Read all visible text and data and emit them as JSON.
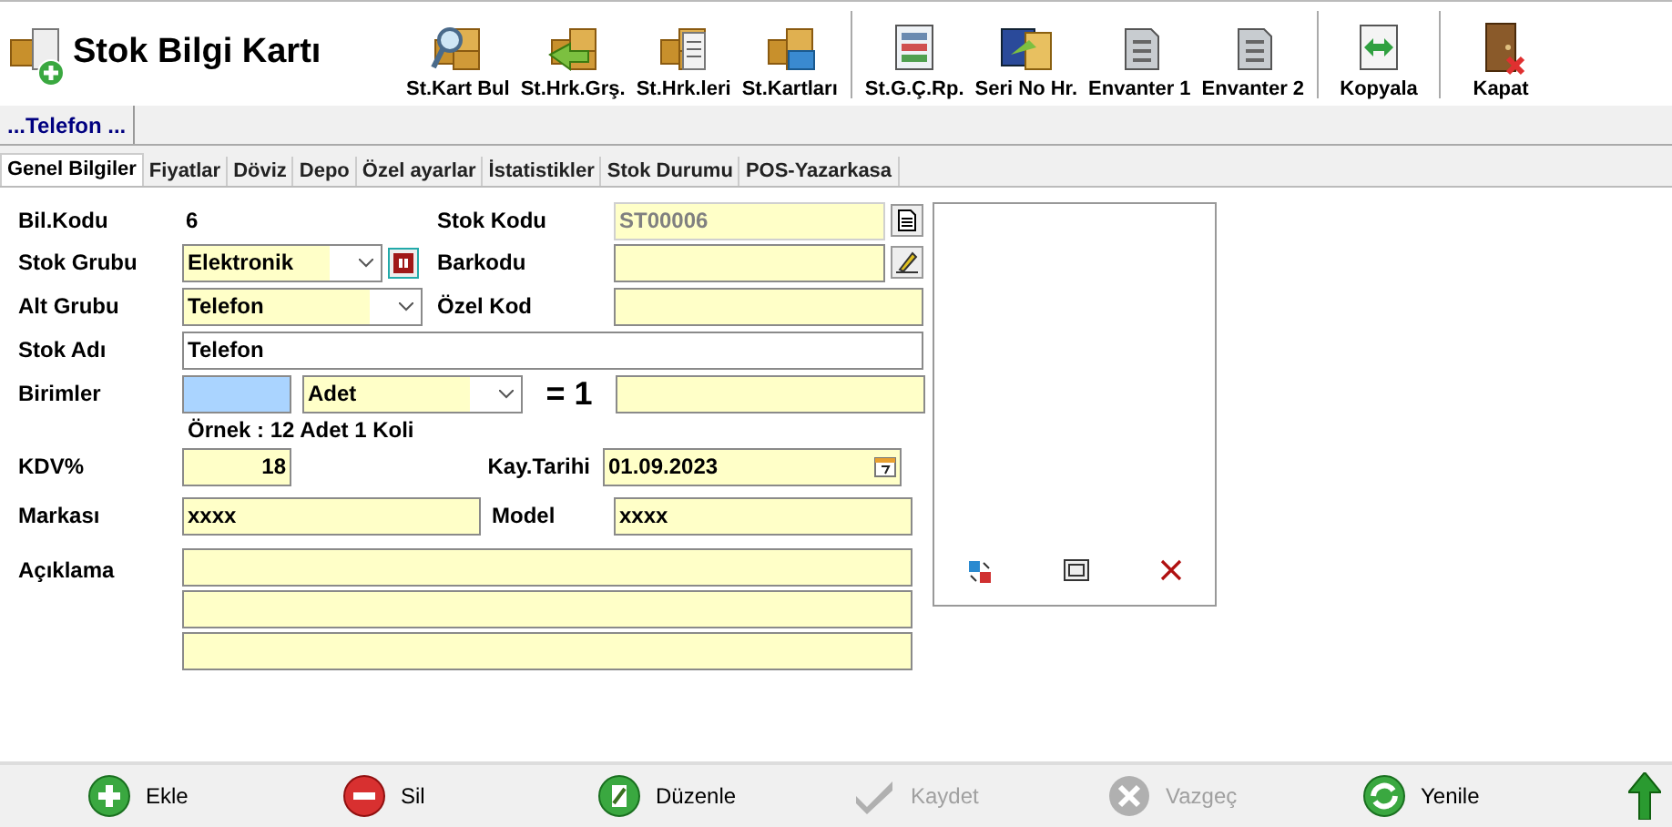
{
  "window": {
    "title": "Stok Bilgi Kartı"
  },
  "toolbar": [
    {
      "kind": "button",
      "label": "St.Kart Bul"
    },
    {
      "kind": "button",
      "label": "St.Hrk.Grş."
    },
    {
      "kind": "button",
      "label": "St.Hrk.leri"
    },
    {
      "kind": "button",
      "label": "St.Kartları"
    },
    {
      "kind": "separator"
    },
    {
      "kind": "button",
      "label": "St.G.Ç.Rp."
    },
    {
      "kind": "button",
      "label": "Seri No Hr."
    },
    {
      "kind": "button",
      "label": "Envanter 1"
    },
    {
      "kind": "button",
      "label": "Envanter 2"
    },
    {
      "kind": "separator"
    },
    {
      "kind": "button",
      "label": "Kopyala"
    },
    {
      "kind": "separator"
    },
    {
      "kind": "button",
      "label": "Kapat"
    }
  ],
  "record_tab": {
    "label": "...Telefon ..."
  },
  "tabs": [
    {
      "label": "Genel Bilgiler",
      "selected": true
    },
    {
      "label": "Fiyatlar",
      "selected": false
    },
    {
      "label": "Döviz",
      "selected": false
    },
    {
      "label": "Depo",
      "selected": false
    },
    {
      "label": "Özel ayarlar",
      "selected": false
    },
    {
      "label": "İstatistikler",
      "selected": false
    },
    {
      "label": "Stok Durumu",
      "selected": false
    },
    {
      "label": "POS-Yazarkasa",
      "selected": false
    }
  ],
  "form": {
    "bil_kodu": {
      "label": "Bil.Kodu",
      "value": "6"
    },
    "stok_kodu": {
      "label": "Stok Kodu",
      "value": "ST00006"
    },
    "stok_grubu": {
      "label": "Stok Grubu",
      "value": "Elektronik"
    },
    "barkodu": {
      "label": "Barkodu"
    },
    "alt_grubu": {
      "label": "Alt Grubu",
      "value": "Telefon"
    },
    "ozel_kod": {
      "label": "Özel Kod"
    },
    "stok_adi": {
      "label": "Stok Adı",
      "value": "Telefon"
    },
    "birimler": {
      "label": "Birimler",
      "unit": "Adet",
      "equals": "= 1"
    },
    "example": "Örnek : 12 Adet 1 Koli",
    "kdv": {
      "label": "KDV%",
      "value": "18"
    },
    "kay_tarihi": {
      "label": "Kay.Tarihi",
      "value": "01.09.2023"
    },
    "markasi": {
      "label": "Markası",
      "value": "xxxx"
    },
    "model": {
      "label": "Model",
      "value": "xxxx"
    },
    "aciklama": {
      "label": "Açıklama"
    }
  },
  "actions": [
    {
      "kind": "add",
      "label": "Ekle",
      "disabled": false
    },
    {
      "kind": "delete",
      "label": "Sil",
      "disabled": false
    },
    {
      "kind": "edit",
      "label": "Düzenle",
      "disabled": false
    },
    {
      "kind": "save",
      "label": "Kaydet",
      "disabled": true
    },
    {
      "kind": "cancel",
      "label": "Vazgeç",
      "disabled": true
    },
    {
      "kind": "refresh",
      "label": "Yenile",
      "disabled": false
    }
  ]
}
